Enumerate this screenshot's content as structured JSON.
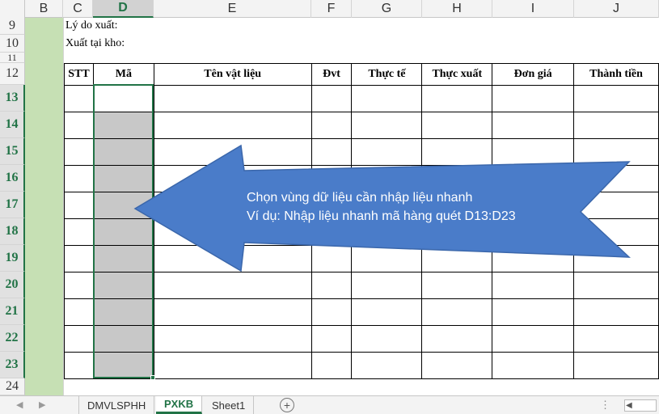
{
  "columns": [
    {
      "letter": "B",
      "selected": false
    },
    {
      "letter": "C",
      "selected": false
    },
    {
      "letter": "D",
      "selected": true
    },
    {
      "letter": "E",
      "selected": false
    },
    {
      "letter": "F",
      "selected": false
    },
    {
      "letter": "G",
      "selected": false
    },
    {
      "letter": "H",
      "selected": false
    },
    {
      "letter": "I",
      "selected": false
    },
    {
      "letter": "J",
      "selected": false
    }
  ],
  "rows": [
    {
      "num": "9",
      "selected": false
    },
    {
      "num": "10",
      "selected": false
    },
    {
      "num": "11",
      "selected": false
    },
    {
      "num": "12",
      "selected": false
    },
    {
      "num": "13",
      "selected": true
    },
    {
      "num": "14",
      "selected": true
    },
    {
      "num": "15",
      "selected": true
    },
    {
      "num": "16",
      "selected": true
    },
    {
      "num": "17",
      "selected": true
    },
    {
      "num": "18",
      "selected": true
    },
    {
      "num": "19",
      "selected": true
    },
    {
      "num": "20",
      "selected": true
    },
    {
      "num": "21",
      "selected": true
    },
    {
      "num": "22",
      "selected": true
    },
    {
      "num": "23",
      "selected": true
    },
    {
      "num": "24",
      "selected": false
    }
  ],
  "sheet": {
    "reason_label": "Lý do xuất:",
    "warehouse_label": "Xuất tại kho:"
  },
  "table": {
    "headers": [
      "STT",
      "Mã",
      "Tên vật liệu",
      "Đvt",
      "Thực tế",
      "Thực xuất",
      "Đơn giá",
      "Thành tiền"
    ],
    "row_count": 11
  },
  "callout": {
    "line1": "Chọn vùng dữ liệu cần nhập liệu nhanh",
    "line2": "Ví dụ: Nhập liệu nhanh mã hàng quét D13:D23",
    "fill_color": "#4a7cc9"
  },
  "tabs": [
    {
      "label": "DMVLSPHH",
      "active": false
    },
    {
      "label": "PXKB",
      "active": true
    },
    {
      "label": "Sheet1",
      "active": false
    }
  ],
  "tabbar": {
    "add_sheet_symbol": "+",
    "ellipsis": "⋮",
    "prev_symbol": "◀",
    "next_symbol": "▶",
    "scroll_left_symbol": "◀"
  },
  "colors": {
    "accent": "#217346",
    "column_b_fill": "#c6e0b4",
    "selection_fill": "#c8c8c8"
  }
}
